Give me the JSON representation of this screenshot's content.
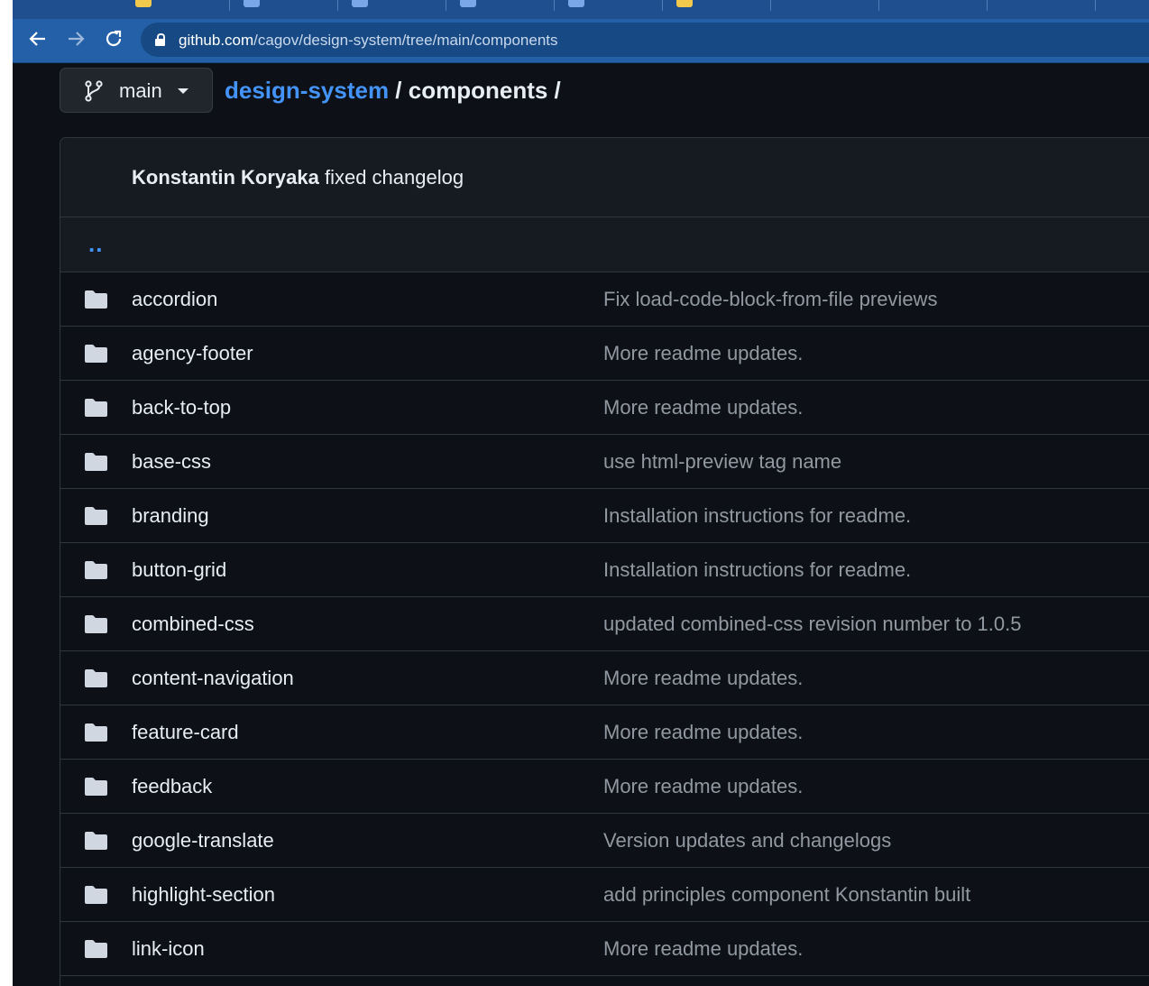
{
  "browser": {
    "back_icon": "arrow-left-icon",
    "forward_icon": "arrow-right-icon",
    "reload_icon": "reload-icon",
    "lock_icon": "lock-icon",
    "url_domain": "github.com",
    "url_path": "/cagov/design-system/tree/main/components"
  },
  "header": {
    "branch_icon": "git-branch-icon",
    "branch_label": "main",
    "breadcrumb_repo": "design-system",
    "breadcrumb_sep1": " / ",
    "breadcrumb_dir": "components",
    "breadcrumb_sep2": " /"
  },
  "latest_commit": {
    "author": "Konstantin Koryaka",
    "message": "fixed changelog"
  },
  "parent_link": "..",
  "files": [
    {
      "name": "accordion",
      "message": "Fix load-code-block-from-file previews"
    },
    {
      "name": "agency-footer",
      "message": "More readme updates."
    },
    {
      "name": "back-to-top",
      "message": "More readme updates."
    },
    {
      "name": "base-css",
      "message": "use html-preview tag name"
    },
    {
      "name": "branding",
      "message": "Installation instructions for readme."
    },
    {
      "name": "button-grid",
      "message": "Installation instructions for readme."
    },
    {
      "name": "combined-css",
      "message": "updated combined-css revision number to 1.0.5"
    },
    {
      "name": "content-navigation",
      "message": "More readme updates."
    },
    {
      "name": "feature-card",
      "message": "More readme updates."
    },
    {
      "name": "feedback",
      "message": "More readme updates."
    },
    {
      "name": "google-translate",
      "message": "Version updates and changelogs"
    },
    {
      "name": "highlight-section",
      "message": "add principles component Konstantin built"
    },
    {
      "name": "link-icon",
      "message": "More readme updates."
    }
  ],
  "colors": {
    "background": "#0d1117",
    "link": "#4493f8",
    "text": "#e6edf3",
    "muted": "#9198a1",
    "border": "#30363d",
    "browser_bar": "#2360a8"
  }
}
